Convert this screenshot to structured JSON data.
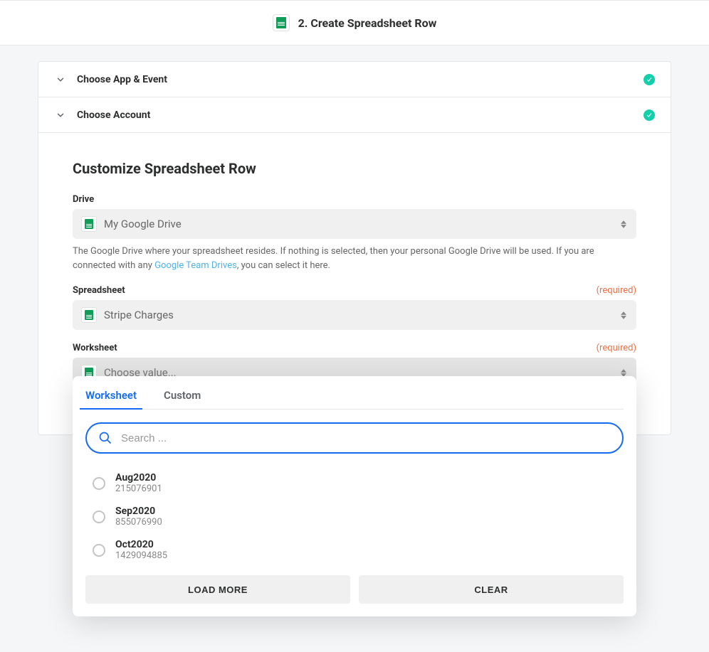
{
  "header": {
    "title": "2. Create Spreadsheet Row"
  },
  "sections": {
    "app_event": {
      "title": "Choose App & Event"
    },
    "account": {
      "title": "Choose Account"
    },
    "customize": {
      "title": "Customize Spreadsheet Row"
    }
  },
  "fields": {
    "drive": {
      "label": "Drive",
      "value": "My Google Drive",
      "help_pre": "The Google Drive where your spreadsheet resides. If nothing is selected, then your personal Google Drive will be used. If you are connected with any ",
      "help_link": "Google Team Drives",
      "help_post": ", you can select it here."
    },
    "spreadsheet": {
      "label": "Spreadsheet",
      "required": "(required)",
      "value": "Stripe Charges"
    },
    "worksheet": {
      "label": "Worksheet",
      "required": "(required)",
      "placeholder": "Choose value..."
    }
  },
  "dropdown": {
    "tabs": {
      "worksheet": "Worksheet",
      "custom": "Custom"
    },
    "search_placeholder": "Search ...",
    "options": [
      {
        "name": "Aug2020",
        "id": "215076901"
      },
      {
        "name": "Sep2020",
        "id": "855076990"
      },
      {
        "name": "Oct2020",
        "id": "1429094885"
      }
    ],
    "load_more": "LOAD MORE",
    "clear": "CLEAR"
  }
}
